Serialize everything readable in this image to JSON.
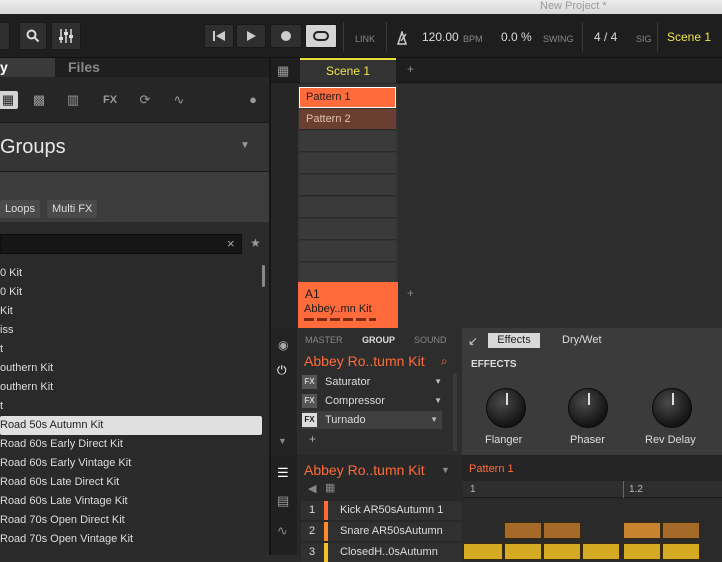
{
  "window": {
    "title": "New Project *"
  },
  "toolbar": {
    "link_label": "LINK",
    "tempo": "120.00",
    "tempo_unit": "BPM",
    "swing": "0.0 %",
    "swing_label": "SWING",
    "signature": "4 / 4",
    "signature_label": "SIG",
    "scene": "Scene 1"
  },
  "browser": {
    "tabs": [
      {
        "label": "y"
      },
      {
        "label": "Files"
      }
    ],
    "category_title": "Groups",
    "chips": [
      "Loops",
      "Multi FX"
    ],
    "search_value": "",
    "items": [
      "0 Kit",
      "0 Kit",
      "Kit",
      "iss",
      "t",
      "outhern Kit",
      "outhern Kit",
      "t",
      "Road 50s Autumn Kit",
      "Road 60s Early Direct Kit",
      "Road 60s Early Vintage Kit",
      "Road 60s Late Direct Kit",
      "Road 60s Late Vintage Kit",
      "Road 70s Open Direct Kit",
      "Road 70s Open Vintage Kit"
    ],
    "selected_index": 8
  },
  "arranger": {
    "scene_tab": "Scene 1",
    "add": "+",
    "patterns": [
      "Pattern 1",
      "Pattern 2"
    ],
    "group_slot": {
      "id": "A1",
      "name": "Abbey..mn Kit"
    }
  },
  "mixer": {
    "tabs": [
      "MASTER",
      "GROUP",
      "SOUND"
    ],
    "active_tab": "GROUP",
    "group_name": "Abbey Ro..tumn Kit",
    "plugins": [
      {
        "badge": "FX",
        "name": "Saturator"
      },
      {
        "badge": "FX",
        "name": "Compressor"
      },
      {
        "badge": "FX",
        "name": "Turnado"
      }
    ],
    "add": "+",
    "fx_tabs": [
      "Effects",
      "Dry/Wet"
    ],
    "section_label": "EFFECTS",
    "knobs": [
      "Flanger",
      "Phaser",
      "Rev Delay"
    ]
  },
  "sequencer": {
    "group_name": "Abbey Ro..tumn Kit",
    "pattern": "Pattern 1",
    "ruler": [
      "1",
      "1.2"
    ],
    "tracks": [
      {
        "num": "1",
        "name": "Kick AR50sAutumn 1"
      },
      {
        "num": "2",
        "name": "Snare AR50sAutumn"
      },
      {
        "num": "3",
        "name": "ClosedH..0sAutumn"
      }
    ]
  },
  "colors": {
    "accent": "#ff6b3a",
    "scene": "#f0e64a"
  }
}
